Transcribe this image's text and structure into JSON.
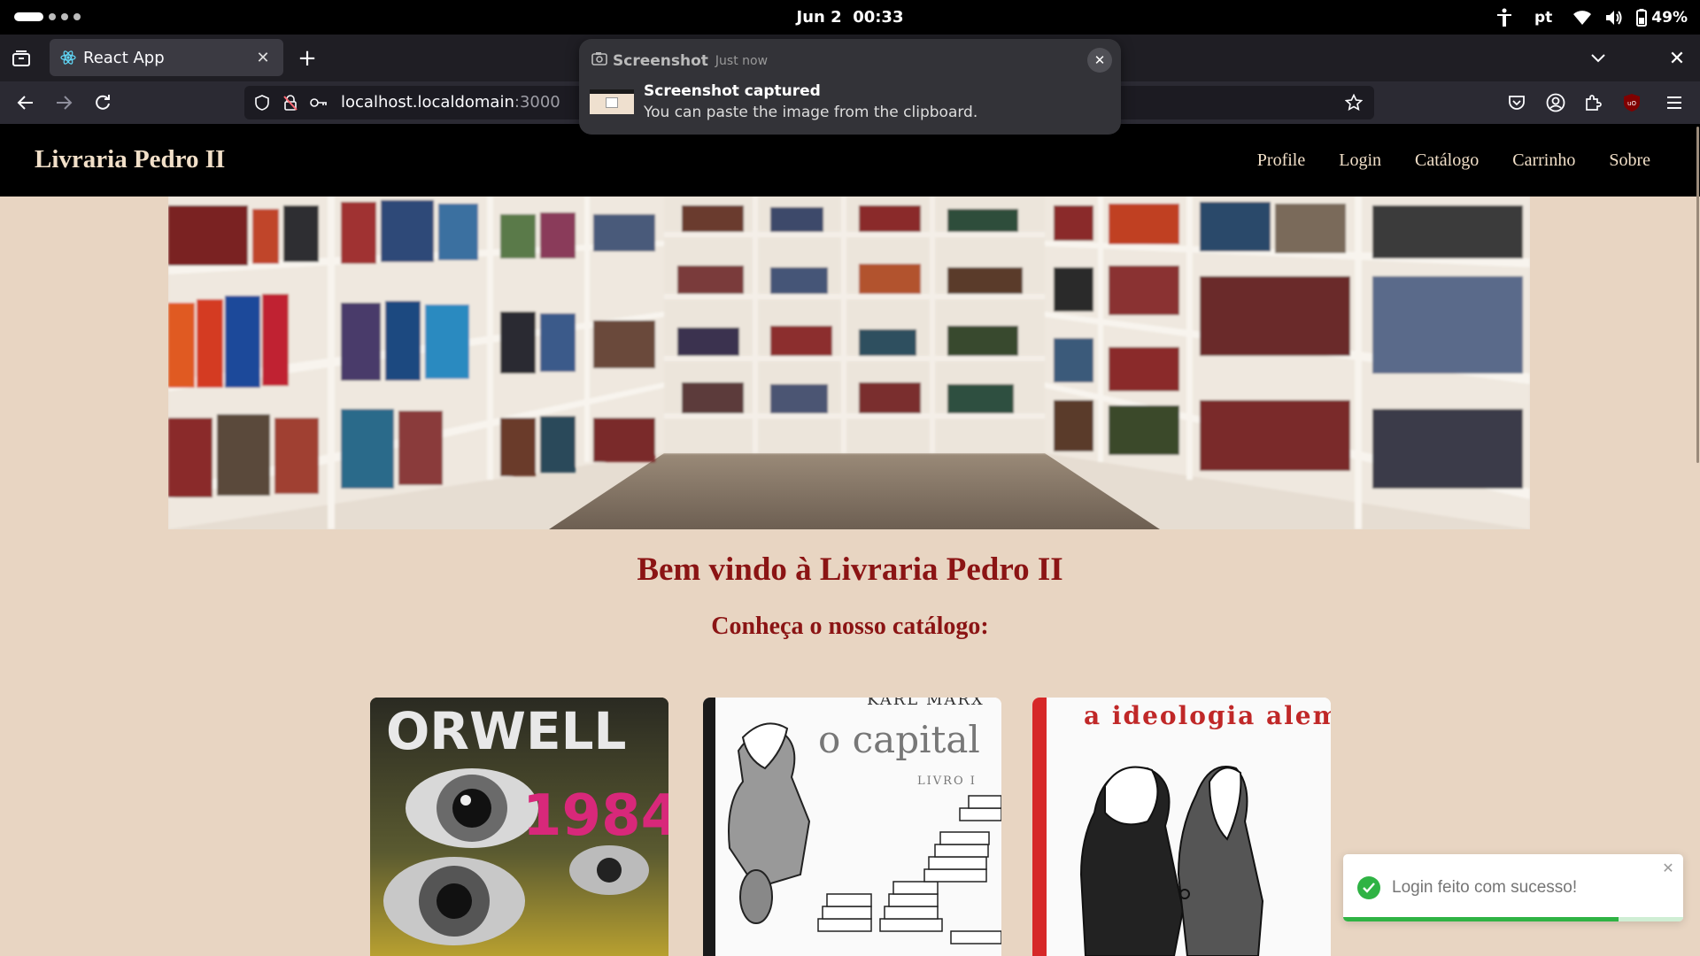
{
  "system": {
    "date": "Jun 2",
    "time": "00:33",
    "keyboard_layout": "pt",
    "battery": "49%"
  },
  "browser": {
    "tab_title": "React App",
    "url_host": "localhost.localdomain",
    "url_port": ":3000"
  },
  "notification": {
    "app": "Screenshot",
    "time": "Just now",
    "title": "Screenshot captured",
    "body": "You can paste the image from the clipboard."
  },
  "site": {
    "brand": "Livraria Pedro II",
    "menu": [
      "Profile",
      "Login",
      "Catálogo",
      "Carrinho",
      "Sobre"
    ],
    "welcome": "Bem vindo à Livraria Pedro II",
    "subtitle": "Conheça o nosso catálogo:"
  },
  "books": [
    {
      "cover_text": [
        "ORWELL",
        "1984"
      ]
    },
    {
      "cover_text": [
        "KARL MARX",
        "o capital",
        "LIVRO I"
      ]
    },
    {
      "cover_text": [
        "a ideologia alemã"
      ]
    }
  ],
  "toast": {
    "message": "Login feito com sucesso!",
    "progress": 0.81,
    "type": "success"
  },
  "colors": {
    "page_bg": "#e8d5c2",
    "accent_red": "#8b1414",
    "header_bg": "#000000",
    "success": "#2fb344"
  }
}
